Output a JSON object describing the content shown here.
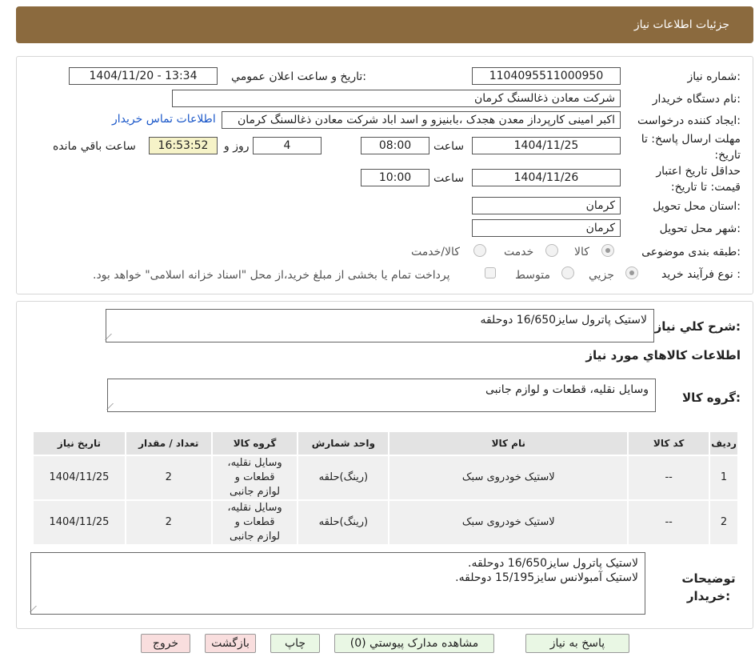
{
  "header": {
    "title": "جزئیات اطلاعات نیاز"
  },
  "form": {
    "need_number_label": "شماره نیاز:",
    "need_number": "1104095511000950",
    "announce_label": "تاریخ و ساعت اعلان عمومي:",
    "announce_value": "1404/11/20 - 13:34",
    "buyer_org_label": "نام دستگاه خریدار:",
    "buyer_org": "شرکت معادن ذغالسنگ کرمان",
    "requester_label": "ایجاد کننده درخواست:",
    "requester": "اکبر امینی کارپرداز معدن هجدک ،بابنیزو و اسد اباد شرکت معادن ذغالسنگ کرمان",
    "contact_link": "اطلاعات تماس خریدار",
    "deadline_label": "مهلت ارسال پاسخ: تا تاریخ:",
    "deadline_date": "1404/11/25",
    "hour_label": "ساعت",
    "deadline_time": "08:00",
    "days_value": "4",
    "days_label": "روز و",
    "remaining_time": "16:53:52",
    "remaining_label": "ساعت باقي مانده",
    "validity_label": "حداقل تاریخ اعتبار قیمت: تا تاریخ:",
    "validity_date": "1404/11/26",
    "validity_time": "10:00",
    "province_label": "استان محل تحویل:",
    "province": "کرمان",
    "city_label": "شهر محل تحویل:",
    "city": "کرمان",
    "category_label": "طبقه بندی موضوعی:",
    "category_options": [
      "کالا",
      "خدمت",
      "کالا/خدمت"
    ],
    "process_label": "نوع فرآیند خرید :",
    "process_options": [
      "جزیي",
      "متوسط"
    ],
    "payment_note": "پرداخت تمام یا بخشی از مبلغ خرید،از محل \"اسناد خزانه اسلامی\" خواهد بود."
  },
  "details": {
    "summary_label": "شرح کلي نیاز:",
    "summary": "لاستیک پاترول سایز16/650 دوحلقه",
    "goods_info_title": "اطلاعات کالاهاي مورد نیاز",
    "group_label": "گروه کالا:",
    "group_value": "وسایل نقلیه، قطعات و لوازم جانبی",
    "table": {
      "headers": [
        "ردیف",
        "کد کالا",
        "نام کالا",
        "واحد شمارش",
        "گروه کالا",
        "تعداد / مقدار",
        "تاریخ نیاز"
      ],
      "rows": [
        [
          "1",
          "--",
          "لاستیک خودروی سبک",
          "(رینگ)حلقه",
          "وسایل نقلیه، قطعات و لوازم جانبی",
          "2",
          "1404/11/25"
        ],
        [
          "2",
          "--",
          "لاستیک خودروی سبک",
          "(رینگ)حلقه",
          "وسایل نقلیه، قطعات و لوازم جانبی",
          "2",
          "1404/11/25"
        ]
      ]
    },
    "buyer_notes_label": "توضیحات خریدار:",
    "buyer_notes_line1": "لاستیک پاترول سایز16/650 دوحلقه.",
    "buyer_notes_line2": "لاستیک آمبولانس سایز15/195 دوحلقه."
  },
  "buttons": {
    "reply": "پاسخ به نیاز",
    "attachments": "مشاهده مدارک پیوستي (0)",
    "print": "چاپ",
    "back": "بازگشت",
    "exit": "خروج"
  }
}
